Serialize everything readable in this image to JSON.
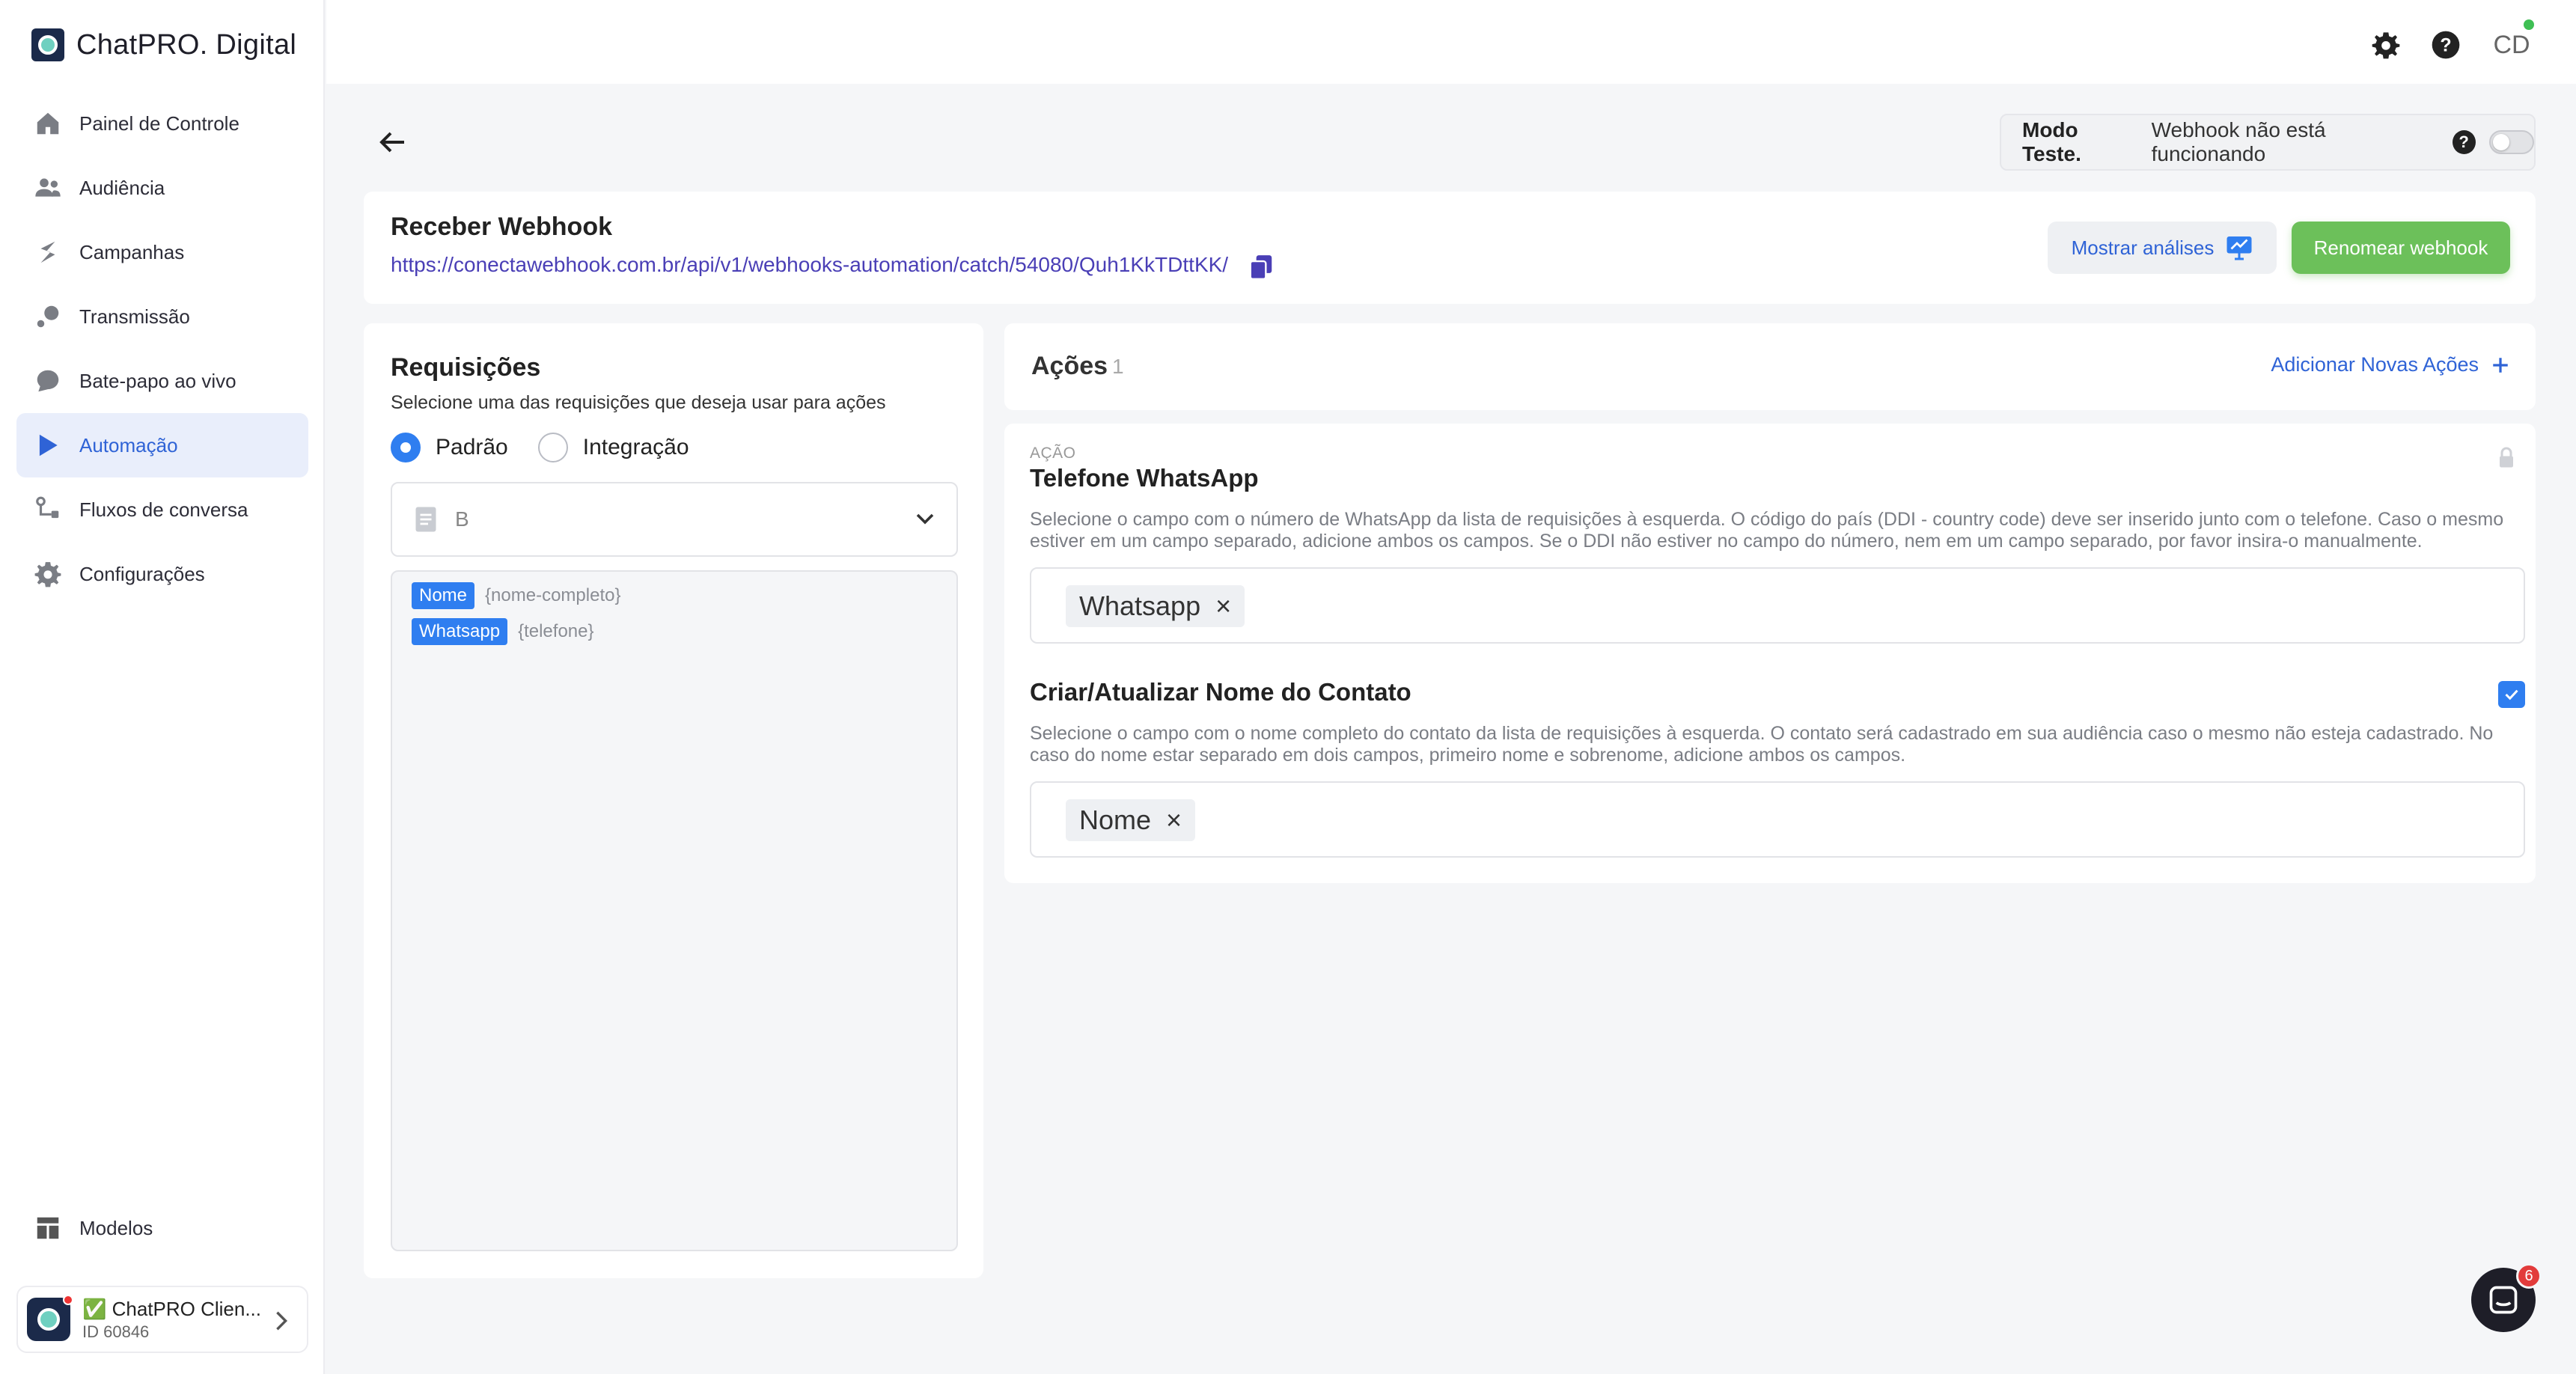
{
  "brand": {
    "name": "ChatPRO. Digital"
  },
  "sidebar": {
    "items": [
      {
        "label": "Painel de Controle",
        "icon": "home-icon"
      },
      {
        "label": "Audiência",
        "icon": "users-icon"
      },
      {
        "label": "Campanhas",
        "icon": "campaign-icon"
      },
      {
        "label": "Transmissão",
        "icon": "broadcast-icon"
      },
      {
        "label": "Bate-papo ao vivo",
        "icon": "chat-bubble-icon"
      },
      {
        "label": "Automação",
        "icon": "play-icon",
        "active": true
      },
      {
        "label": "Fluxos de conversa",
        "icon": "flow-icon"
      },
      {
        "label": "Configurações",
        "icon": "gear-icon"
      }
    ],
    "bottom": {
      "label": "Modelos",
      "icon": "templates-icon"
    },
    "account": {
      "name": "✅ ChatPRO Clien...",
      "id": "ID 60846"
    }
  },
  "header": {
    "avatar_initials": "CD"
  },
  "test_mode": {
    "label": "Modo Teste.",
    "status": "Webhook não está funcionando",
    "enabled": false
  },
  "webhook": {
    "title": "Receber Webhook",
    "url": "https://conectawebhook.com.br/api/v1/webhooks-automation/catch/54080/Quh1KkTDttKK/",
    "analysis_button": "Mostrar análises",
    "rename_button": "Renomear webhook"
  },
  "requests": {
    "title": "Requisições",
    "subtitle": "Selecione uma das requisições que deseja usar para ações",
    "radio_options": [
      "Padrão",
      "Integração"
    ],
    "selected_radio": "Padrão",
    "selected_request": "B",
    "fields": [
      {
        "label": "Nome",
        "var": "{nome-completo}"
      },
      {
        "label": "Whatsapp",
        "var": "{telefone}"
      }
    ]
  },
  "actions": {
    "title": "Ações",
    "count": "1",
    "add_label": "Adicionar Novas Ações",
    "caption": "AÇÃO",
    "phone": {
      "title": "Telefone WhatsApp",
      "desc": "Selecione o campo com o número de WhatsApp da lista de requisições à esquerda. O código do país (DDI - country code) deve ser inserido junto com o telefone. Caso o mesmo estiver em um campo separado, adicione ambos os campos. Se o DDI não estiver no campo do número, nem em um campo separado, por favor insira-o manualmente.",
      "chip": "Whatsapp"
    },
    "contact": {
      "title": "Criar/Atualizar Nome do Contato",
      "desc": "Selecione o campo com o nome completo do contato da lista de requisições à esquerda. O contato será cadastrado em sua audiência caso o mesmo não esteja cadastrado. No caso do nome estar separado em dois campos, primeiro nome e sobrenome, adicione ambos os campos.",
      "chip": "Nome",
      "checked": true
    }
  },
  "chat_widget": {
    "badge": "6"
  },
  "colors": {
    "accent": "#2f7ef0",
    "link": "#2f63d6",
    "success": "#6cc05a",
    "url": "#4a3fb6"
  }
}
